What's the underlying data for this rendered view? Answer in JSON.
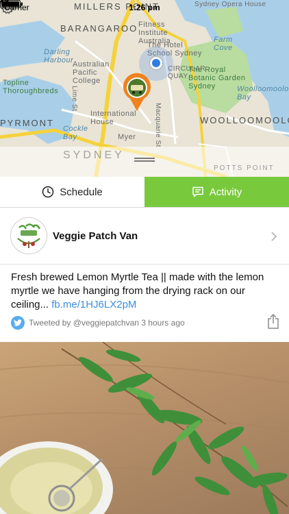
{
  "status_bar": {
    "carrier": "Carrier",
    "time": "1:26 pm"
  },
  "map": {
    "labels": {
      "millers_point": "MILLERS POINT",
      "barangaroo": "BARANGAROO",
      "fitness_institute": "Fitness Institute Australia",
      "the_hotel_school": "The Hotel School Sydney",
      "farm_cove": "Farm Cove",
      "darling_harbour": "Darling Harbour",
      "australian_pacific": "Australian Pacific College",
      "circular_quay": "CIRCULAR QUAY",
      "botanic_garden": "The Royal Botanic Garden Sydney",
      "topline": "Topline Thoroughbreds",
      "woolloomooloo_bay": "Woolloomooloo Bay",
      "lime_st": "Lime St",
      "pyrmont": "PYRMONT",
      "international_house": "International House",
      "woolloomooloo": "WOOLLOOMOOLOO",
      "cockle_bay": "Cockle Bay",
      "myer": "Myer",
      "macquarie_st": "Macquarie St",
      "sydney": "SYDNEY",
      "potts_point": "POTTS POINT",
      "sydney_opera_house": "Sydney Opera House"
    }
  },
  "tabs": {
    "schedule": "Schedule",
    "activity": "Activity"
  },
  "profile": {
    "name": "Veggie Patch Van"
  },
  "tweet": {
    "text": "Fresh brewed Lemon Myrtle Tea || made with the lemon myrtle we have hanging from the drying rack on our ceiling... ",
    "link": "fb.me/1HJ6LX2pM",
    "meta": "Tweeted by @veggiepatchvan 3 hours ago"
  },
  "colors": {
    "accent_green": "#79c93d",
    "link_blue": "#3b8de0",
    "twitter_blue": "#55acee",
    "marker_orange": "#f0821e"
  },
  "icons": [
    "wifi-icon",
    "location-arrow-icon",
    "battery-icon",
    "location-dot-icon",
    "van-marker-icon",
    "drag-handle-icon",
    "gear-icon",
    "clock-icon",
    "chat-icon",
    "chevron-right-icon",
    "twitter-icon",
    "share-icon"
  ]
}
